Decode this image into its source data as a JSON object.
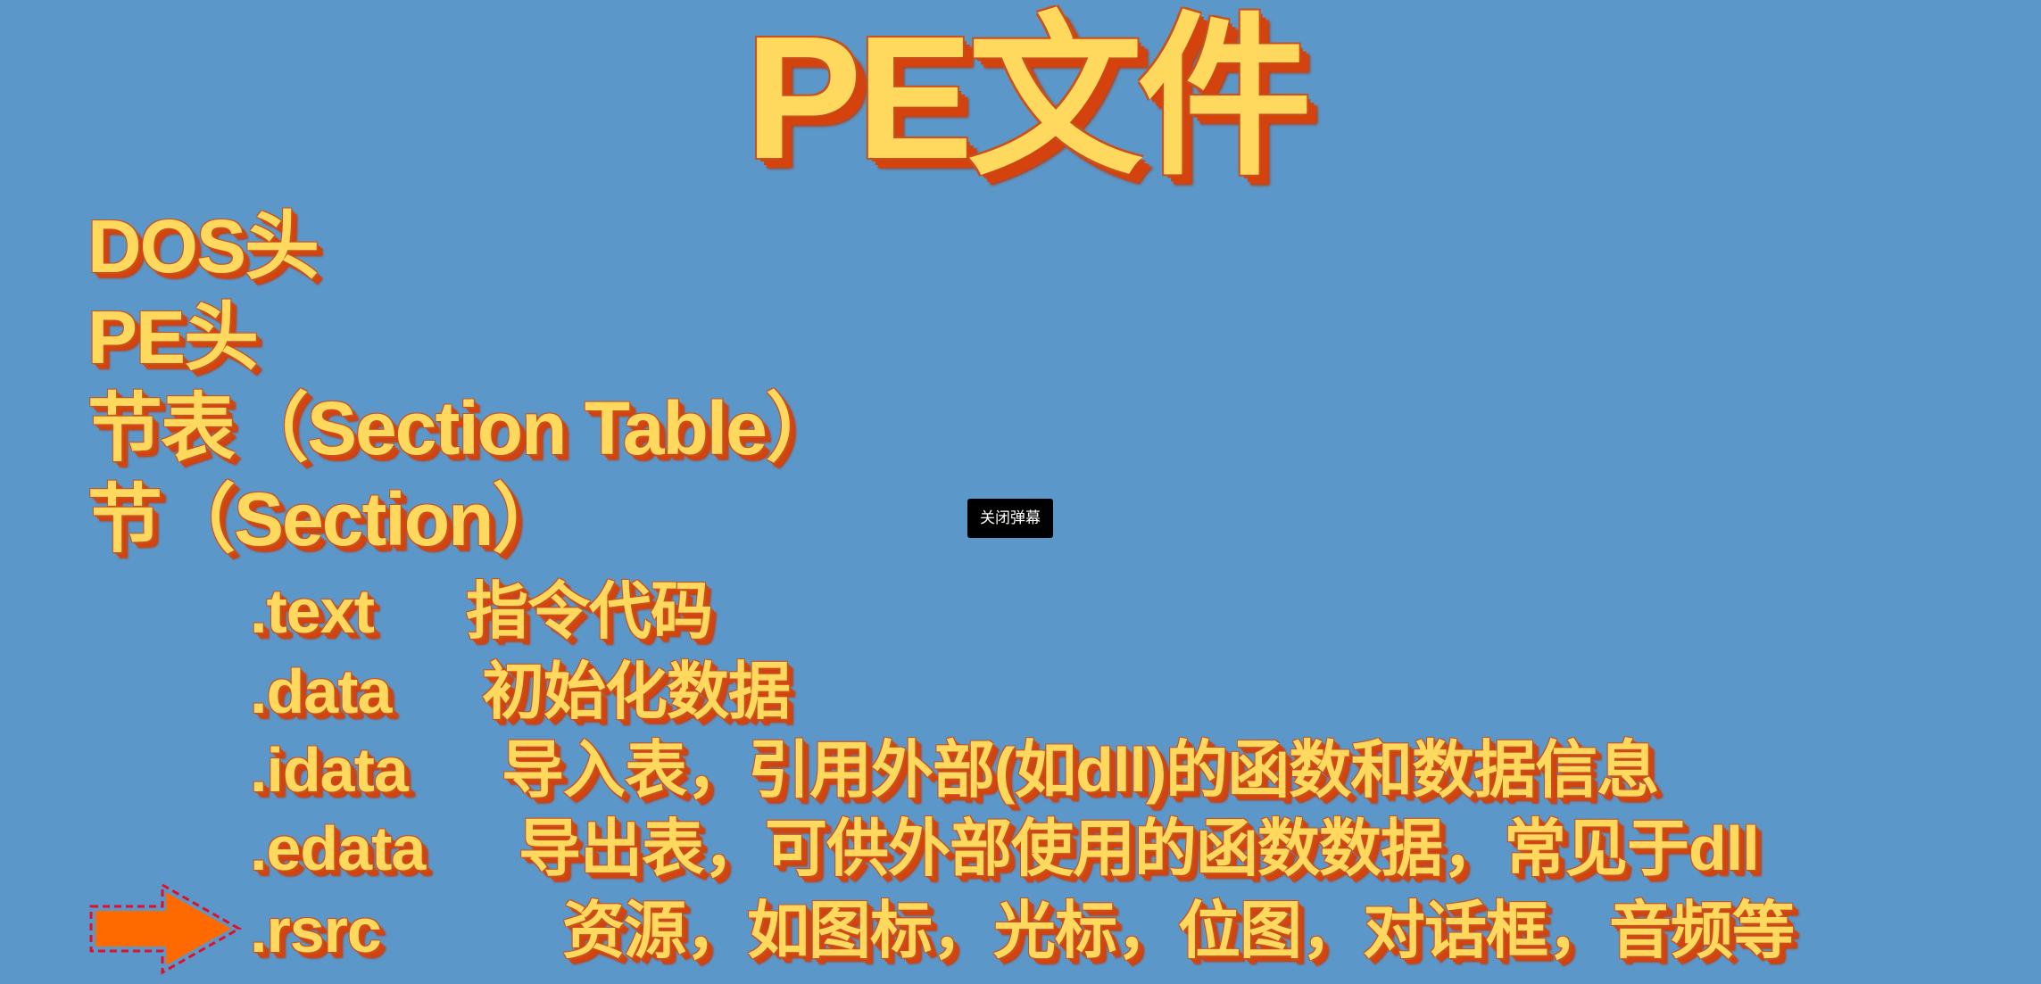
{
  "slide": {
    "title": "PE文件",
    "headings": [
      "DOS头",
      "PE头",
      "节表（Section Table）",
      "节（Section）"
    ],
    "sections": [
      {
        "name": ".text",
        "desc": "指令代码"
      },
      {
        "name": ".data",
        "desc": "初始化数据"
      },
      {
        "name": ".idata",
        "desc": "导入表，引用外部(如dll)的函数和数据信息"
      },
      {
        "name": ".edata",
        "desc": "导出表，可供外部使用的函数数据，常见于dll"
      },
      {
        "name": ".rsrc",
        "desc": "资源，如图标，光标，位图，对话框，音频等"
      }
    ],
    "pointer_icon": "arrow-right-icon"
  },
  "overlay": {
    "close_danmaku_label": "关闭弹幕"
  },
  "colors": {
    "background": "#5b97c9",
    "text": "#ffd95e",
    "shadow": "#d4420e",
    "arrow": "#ff6a00"
  }
}
